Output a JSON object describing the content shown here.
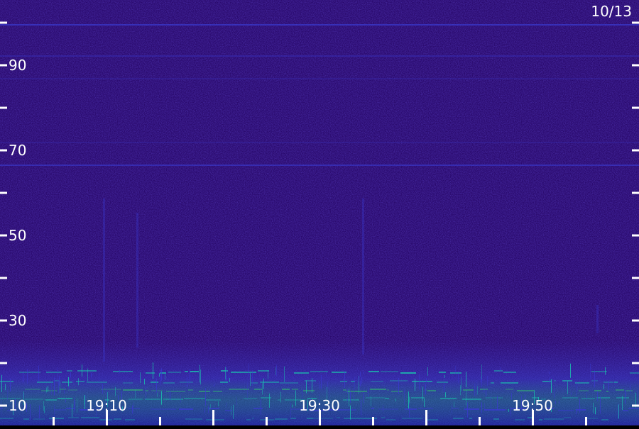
{
  "chart_data": {
    "type": "heatmap",
    "date_label": "10/13",
    "y_axis": {
      "min": 10,
      "max": 100,
      "major_ticks": [
        10,
        30,
        50,
        70,
        90
      ],
      "minor_ticks": [
        20,
        40,
        60,
        80,
        100
      ],
      "tick_labels": [
        "10",
        "30",
        "50",
        "70",
        "90"
      ]
    },
    "x_axis": {
      "tick_labels": [
        "19:10",
        "19:30",
        "19:50"
      ]
    },
    "colors": {
      "background": "#2a0a6e",
      "band": "#3a3ad0",
      "strong": "#18c8b0",
      "peak": "#30e060",
      "axis": "#ffffff"
    }
  }
}
